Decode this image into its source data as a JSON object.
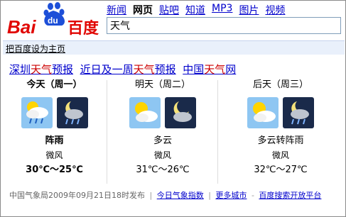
{
  "logo": {
    "bai": "Bai",
    "du": "du",
    "cn": "百度"
  },
  "nav": {
    "items": [
      "新闻",
      "网页",
      "贴吧",
      "知道",
      "MP3",
      "图片",
      "视频"
    ],
    "current": "网页"
  },
  "search": {
    "value": "天气"
  },
  "homepage_link": "把百度设为主页",
  "title": {
    "p1a": "深圳",
    "p1b": "天气",
    "p1c": "预报",
    "p2a": "近日及一周",
    "p2b": "天气",
    "p2c": "预报",
    "p3a": "中国",
    "p3b": "天气",
    "p3c": "网"
  },
  "days": [
    {
      "day": "今天（周一）",
      "condition": "阵雨",
      "wind": "微风",
      "temp": "30℃～25℃",
      "icons": [
        "partly-cloudy-rain-icon",
        "night-rain-icon"
      ]
    },
    {
      "day": "明天（周二）",
      "condition": "多云",
      "wind": "微风",
      "temp": "31℃～26℃",
      "icons": [
        "partly-cloudy-icon",
        "night-cloudy-icon"
      ]
    },
    {
      "day": "后天（周三）",
      "condition": "多云转阵雨",
      "wind": "微风",
      "temp": "32℃～27℃",
      "icons": [
        "partly-cloudy-icon",
        "night-rain-icon"
      ]
    }
  ],
  "footer": {
    "source": "中国气象局2009年09月21日18时发布",
    "link1": "今日气象指数",
    "link2": "更多城市",
    "link3": "百度搜索开放平台"
  },
  "colors": {
    "link": "#0000cc",
    "highlight": "#cc0000",
    "bar": "#e9f0fb"
  }
}
